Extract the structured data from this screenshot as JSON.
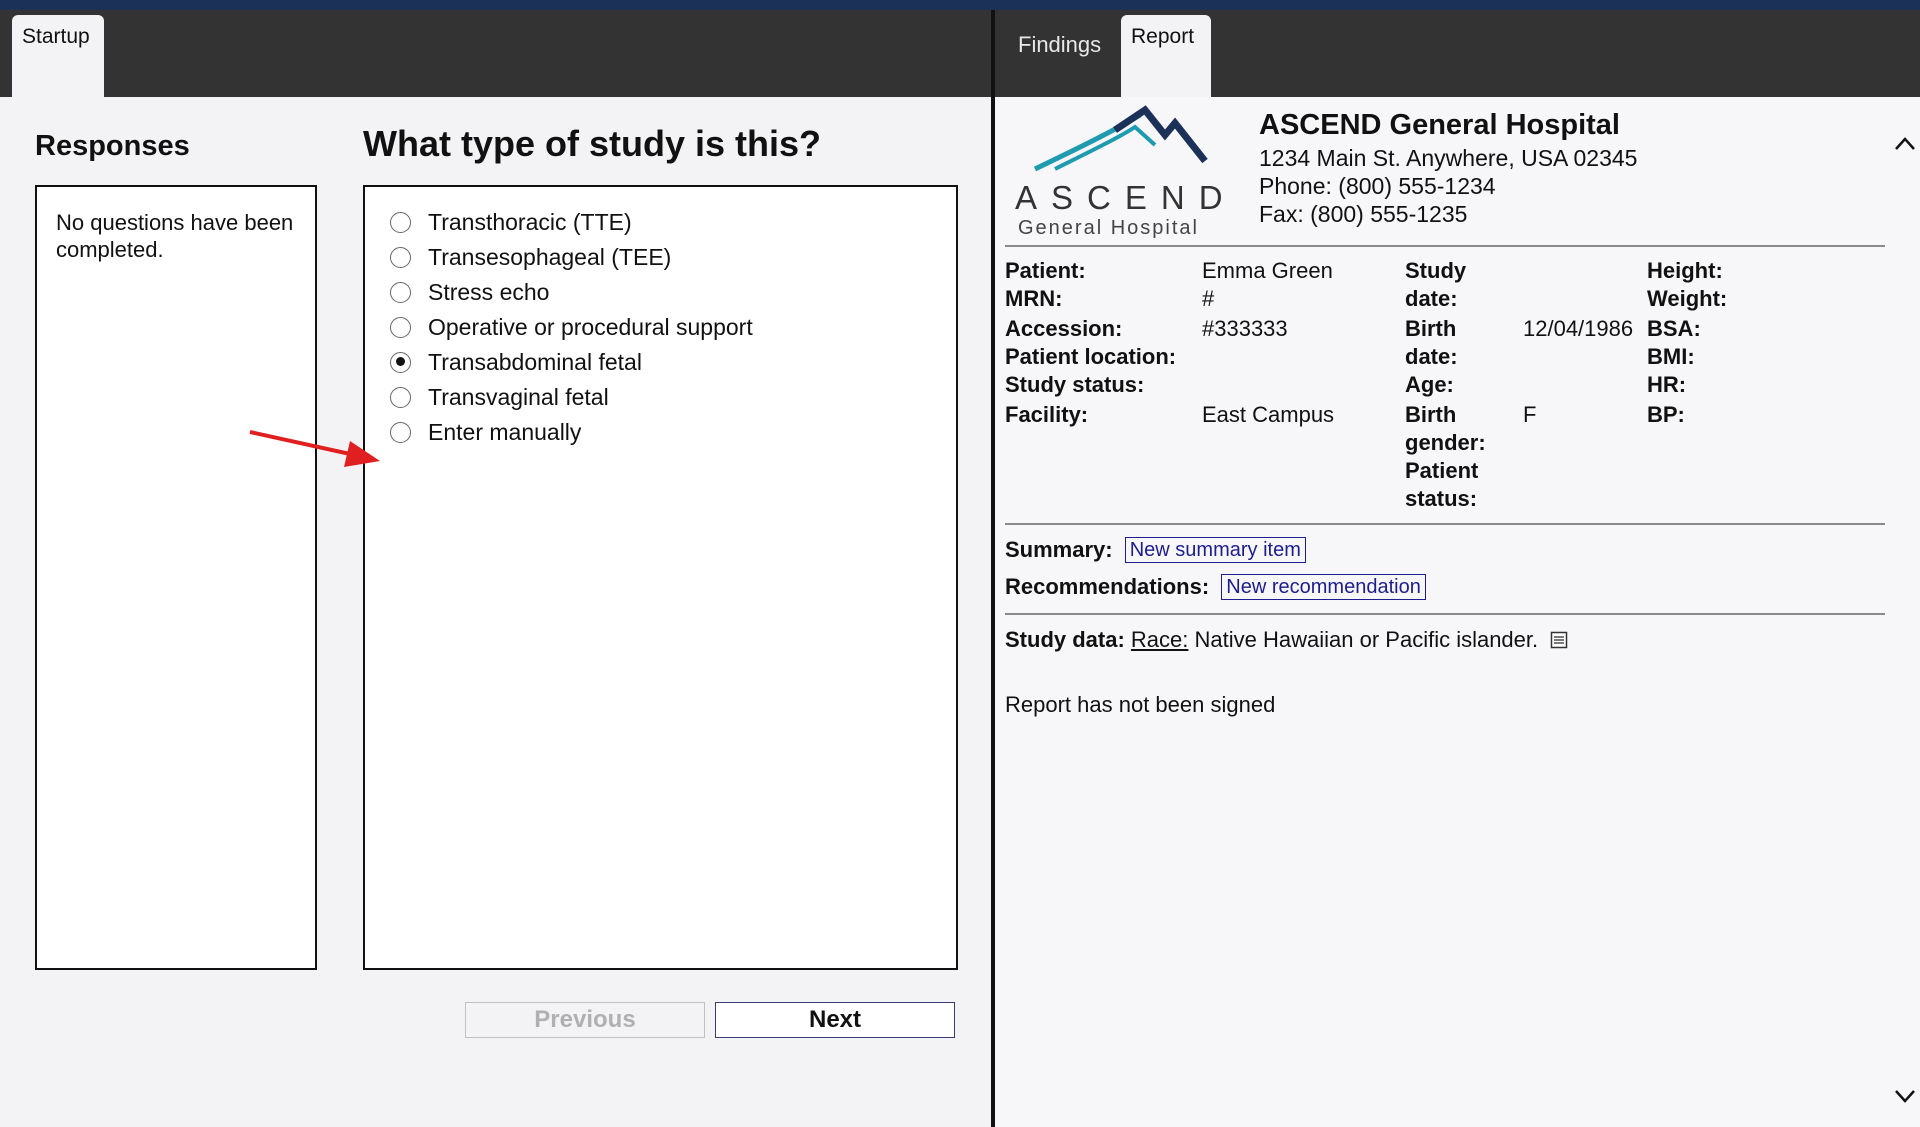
{
  "tabs_left": {
    "startup": "Startup"
  },
  "tabs_right": {
    "findings": "Findings",
    "report": "Report"
  },
  "responses": {
    "title": "Responses",
    "empty_text": "No questions have been completed."
  },
  "question": {
    "title": "What type of study is this?",
    "options": [
      {
        "label": "Transthoracic (TTE)",
        "selected": false
      },
      {
        "label": "Transesophageal (TEE)",
        "selected": false
      },
      {
        "label": "Stress echo",
        "selected": false
      },
      {
        "label": "Operative or procedural support",
        "selected": false
      },
      {
        "label": "Transabdominal fetal",
        "selected": true
      },
      {
        "label": "Transvaginal fetal",
        "selected": false
      },
      {
        "label": "Enter manually",
        "selected": false
      }
    ]
  },
  "buttons": {
    "previous": "Previous",
    "next": "Next"
  },
  "report": {
    "logo": {
      "word": "ASCEND",
      "sub": "General Hospital"
    },
    "hospital": {
      "name": "ASCEND General Hospital",
      "address": "1234 Main St. Anywhere, USA 02345",
      "phone": "Phone: (800) 555-1234",
      "fax": "Fax: (800) 555-1235"
    },
    "patient": {
      "patient_label": "Patient:",
      "patient_value": "Emma Green",
      "mrn_label": "MRN:",
      "mrn_value": "#",
      "accession_label": "Accession:",
      "accession_value": "#333333",
      "location_label": "Patient location:",
      "status_label": "Study status:",
      "facility_label": "Facility:",
      "facility_value": "East Campus",
      "study_date_label_1": "Study",
      "study_date_label_2": "date:",
      "birth_date_label_1": "Birth",
      "birth_date_label_2": "date:",
      "birth_date_value": "12/04/1986",
      "age_label": "Age:",
      "birth_gender_label_1": "Birth",
      "birth_gender_label_2": "gender:",
      "birth_gender_value": "F",
      "patient_status_label_1": "Patient",
      "patient_status_label_2": "status:",
      "height_label": "Height:",
      "weight_label": "Weight:",
      "bsa_label": "BSA:",
      "bmi_label": "BMI:",
      "hr_label": "HR:",
      "bp_label": "BP:"
    },
    "summary_label": "Summary:",
    "summary_link": "New summary item",
    "recommendations_label": "Recommendations:",
    "recommendations_link": "New recommendation",
    "study_data_label": "Study data:",
    "race_label": "Race:",
    "race_value": "Native Hawaiian or Pacific islander.",
    "sign_status": "Report has not been signed"
  },
  "colors": {
    "topstrip": "#1c3158",
    "tabbar": "#333333",
    "arrow": "#e02020",
    "link": "#1d1d8c",
    "logo_teal": "#1f9bb0",
    "logo_navy": "#1c3158"
  }
}
